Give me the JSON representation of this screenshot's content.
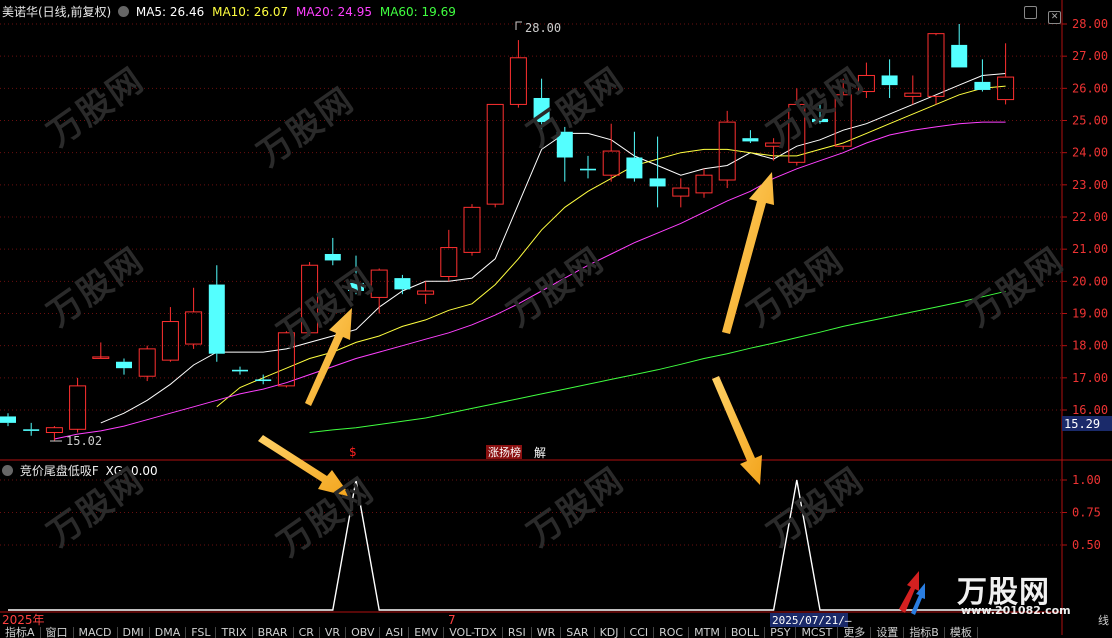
{
  "header": {
    "stock_title": "美诺华(日线,前复权)",
    "ma5": "MA5: 26.46",
    "ma10": "MA10: 26.07",
    "ma20": "MA20: 24.95",
    "ma60": "MA60: 19.69",
    "ma5_color": "#ffffff",
    "ma10_color": "#ffff40",
    "ma20_color": "#ff40ff",
    "ma60_color": "#40ff40"
  },
  "sub_header": {
    "indicator": "竞价尾盘低吸F",
    "xg": "XG: 0.00"
  },
  "labels": {
    "high_price": "28.00",
    "low_price": "15.02",
    "current_price": "15.29",
    "marker_s": "$",
    "marker_limit": "涨扬榜",
    "marker_jie": "解",
    "year_label": "2025年",
    "month_label": "7",
    "date_label": "2025/07/21/—",
    "line_label": "线"
  },
  "price_axis_ticks": [
    "28.00",
    "27.00",
    "26.00",
    "25.00",
    "24.00",
    "23.00",
    "22.00",
    "21.00",
    "20.00",
    "19.00",
    "18.00",
    "17.00",
    "16.00"
  ],
  "sub_axis_ticks": [
    "1.00",
    "0.75",
    "0.50"
  ],
  "tabs": [
    "指标A",
    "窗口",
    "MACD",
    "DMI",
    "DMA",
    "FSL",
    "TRIX",
    "BRAR",
    "CR",
    "VR",
    "OBV",
    "ASI",
    "EMV",
    "VOL-TDX",
    "RSI",
    "WR",
    "SAR",
    "KDJ",
    "CCI",
    "ROC",
    "MTM",
    "BOLL",
    "PSY",
    "MCST",
    "更多",
    "设置",
    "指标B",
    "模板"
  ],
  "brand": {
    "name": "万股网",
    "site": "www.201082.com"
  },
  "watermark": "万股网",
  "chart_data": [
    {
      "type": "candlestick",
      "title": "美诺华(日线,前复权)",
      "ylim": [
        15.2,
        28.3
      ],
      "candles": [
        {
          "o": 15.8,
          "h": 15.9,
          "l": 15.5,
          "c": 15.6
        },
        {
          "o": 15.4,
          "h": 15.6,
          "l": 15.2,
          "c": 15.35
        },
        {
          "o": 15.3,
          "h": 15.5,
          "l": 15.02,
          "c": 15.45
        },
        {
          "o": 15.4,
          "h": 17.0,
          "l": 15.3,
          "c": 16.75
        },
        {
          "o": 17.65,
          "h": 18.1,
          "l": 17.6,
          "c": 17.65
        },
        {
          "o": 17.5,
          "h": 17.6,
          "l": 17.1,
          "c": 17.3
        },
        {
          "o": 17.05,
          "h": 18.0,
          "l": 16.9,
          "c": 17.9
        },
        {
          "o": 17.55,
          "h": 19.2,
          "l": 17.5,
          "c": 18.75
        },
        {
          "o": 18.05,
          "h": 19.8,
          "l": 17.9,
          "c": 19.05
        },
        {
          "o": 19.9,
          "h": 20.5,
          "l": 17.5,
          "c": 17.75
        },
        {
          "o": 17.25,
          "h": 17.35,
          "l": 17.1,
          "c": 17.2
        },
        {
          "o": 16.95,
          "h": 17.1,
          "l": 16.8,
          "c": 16.9
        },
        {
          "o": 16.75,
          "h": 18.45,
          "l": 16.7,
          "c": 18.4
        },
        {
          "o": 18.4,
          "h": 20.6,
          "l": 18.3,
          "c": 20.5
        },
        {
          "o": 20.85,
          "h": 21.35,
          "l": 20.5,
          "c": 20.65
        },
        {
          "o": 19.95,
          "h": 20.8,
          "l": 19.6,
          "c": 19.7
        },
        {
          "o": 19.5,
          "h": 20.4,
          "l": 19.0,
          "c": 20.35
        },
        {
          "o": 20.1,
          "h": 20.2,
          "l": 19.6,
          "c": 19.75
        },
        {
          "o": 19.6,
          "h": 20.0,
          "l": 19.3,
          "c": 19.7
        },
        {
          "o": 20.15,
          "h": 21.6,
          "l": 20.0,
          "c": 21.05
        },
        {
          "o": 20.9,
          "h": 22.4,
          "l": 20.8,
          "c": 22.3
        },
        {
          "o": 22.4,
          "h": 25.5,
          "l": 22.3,
          "c": 25.5
        },
        {
          "o": 25.5,
          "h": 27.5,
          "l": 25.4,
          "c": 26.95
        },
        {
          "o": 25.7,
          "h": 26.3,
          "l": 24.7,
          "c": 24.95
        },
        {
          "o": 24.65,
          "h": 24.8,
          "l": 23.1,
          "c": 23.85
        },
        {
          "o": 23.5,
          "h": 23.9,
          "l": 23.2,
          "c": 23.45
        },
        {
          "o": 23.3,
          "h": 24.9,
          "l": 23.1,
          "c": 24.05
        },
        {
          "o": 23.85,
          "h": 24.65,
          "l": 23.1,
          "c": 23.2
        },
        {
          "o": 23.2,
          "h": 24.5,
          "l": 22.3,
          "c": 22.95
        },
        {
          "o": 22.65,
          "h": 23.2,
          "l": 22.3,
          "c": 22.9
        },
        {
          "o": 22.75,
          "h": 23.5,
          "l": 22.6,
          "c": 23.3
        },
        {
          "o": 23.15,
          "h": 25.3,
          "l": 22.9,
          "c": 24.95
        },
        {
          "o": 24.45,
          "h": 24.7,
          "l": 24.3,
          "c": 24.35
        },
        {
          "o": 24.2,
          "h": 24.45,
          "l": 23.75,
          "c": 24.3
        },
        {
          "o": 23.7,
          "h": 26.0,
          "l": 23.6,
          "c": 25.5
        },
        {
          "o": 25.05,
          "h": 25.55,
          "l": 24.9,
          "c": 24.95
        },
        {
          "o": 24.2,
          "h": 26.3,
          "l": 24.1,
          "c": 25.8
        },
        {
          "o": 25.9,
          "h": 26.8,
          "l": 25.7,
          "c": 26.4
        },
        {
          "o": 26.4,
          "h": 26.9,
          "l": 25.7,
          "c": 26.1
        },
        {
          "o": 25.75,
          "h": 26.4,
          "l": 25.5,
          "c": 25.85
        },
        {
          "o": 25.75,
          "h": 27.65,
          "l": 25.5,
          "c": 27.7
        },
        {
          "o": 27.35,
          "h": 28.0,
          "l": 26.65,
          "c": 26.65
        },
        {
          "o": 26.2,
          "h": 26.9,
          "l": 25.9,
          "c": 25.95
        },
        {
          "o": 25.65,
          "h": 27.4,
          "l": 25.5,
          "c": 26.35
        }
      ],
      "series": [
        {
          "name": "MA5",
          "color": "#ffffff",
          "values": [
            null,
            null,
            null,
            null,
            15.6,
            15.9,
            16.3,
            16.8,
            17.4,
            17.8,
            17.8,
            17.8,
            17.9,
            18.1,
            18.3,
            18.5,
            19.2,
            19.7,
            20.0,
            20.0,
            20.1,
            20.7,
            22.4,
            24.1,
            24.6,
            24.6,
            24.4,
            23.9,
            23.6,
            23.3,
            23.5,
            23.6,
            24.0,
            23.8,
            24.2,
            24.4,
            24.7,
            24.9,
            25.2,
            25.5,
            25.8,
            26.1,
            26.4,
            26.46
          ]
        },
        {
          "name": "MA10",
          "color": "#ffff40",
          "values": [
            null,
            null,
            null,
            null,
            null,
            null,
            null,
            null,
            null,
            16.1,
            16.7,
            17.0,
            17.3,
            17.6,
            17.8,
            18.1,
            18.3,
            18.6,
            18.8,
            19.1,
            19.3,
            19.9,
            20.7,
            21.6,
            22.3,
            22.8,
            23.2,
            23.6,
            23.8,
            24.0,
            24.1,
            24.1,
            24.0,
            23.9,
            23.9,
            24.1,
            24.3,
            24.6,
            24.9,
            25.2,
            25.5,
            25.8,
            26.0,
            26.07
          ]
        },
        {
          "name": "MA20",
          "color": "#ff40ff",
          "values": [
            null,
            null,
            15.1,
            15.25,
            15.35,
            15.5,
            15.7,
            15.9,
            16.1,
            16.3,
            16.5,
            16.65,
            16.85,
            17.1,
            17.35,
            17.6,
            17.8,
            18.0,
            18.2,
            18.4,
            18.65,
            18.95,
            19.3,
            19.7,
            20.1,
            20.5,
            20.85,
            21.2,
            21.5,
            21.8,
            22.15,
            22.5,
            22.8,
            23.2,
            23.5,
            23.75,
            24.0,
            24.3,
            24.55,
            24.7,
            24.8,
            24.9,
            24.95,
            24.95
          ]
        },
        {
          "name": "MA60",
          "color": "#40ff40",
          "values": [
            null,
            null,
            null,
            null,
            null,
            null,
            null,
            null,
            null,
            null,
            null,
            null,
            null,
            15.3,
            15.38,
            15.45,
            15.55,
            15.65,
            15.75,
            15.9,
            16.05,
            16.2,
            16.35,
            16.5,
            16.65,
            16.8,
            16.95,
            17.1,
            17.25,
            17.42,
            17.6,
            17.75,
            17.92,
            18.08,
            18.25,
            18.42,
            18.6,
            18.75,
            18.9,
            19.05,
            19.2,
            19.35,
            19.52,
            19.69
          ]
        }
      ]
    },
    {
      "type": "line",
      "title": "竞价尾盘低吸F",
      "series_name": "XG",
      "ylim": [
        0,
        1.05
      ],
      "values": [
        0,
        0,
        0,
        0,
        0,
        0,
        0,
        0,
        0,
        0,
        0,
        0,
        0,
        0,
        0,
        1,
        0,
        0,
        0,
        0,
        0,
        0,
        0,
        0,
        0,
        0,
        0,
        0,
        0,
        0,
        0,
        0,
        0,
        0,
        1,
        0,
        0,
        0,
        0,
        0,
        0,
        0,
        0,
        0
      ]
    }
  ]
}
